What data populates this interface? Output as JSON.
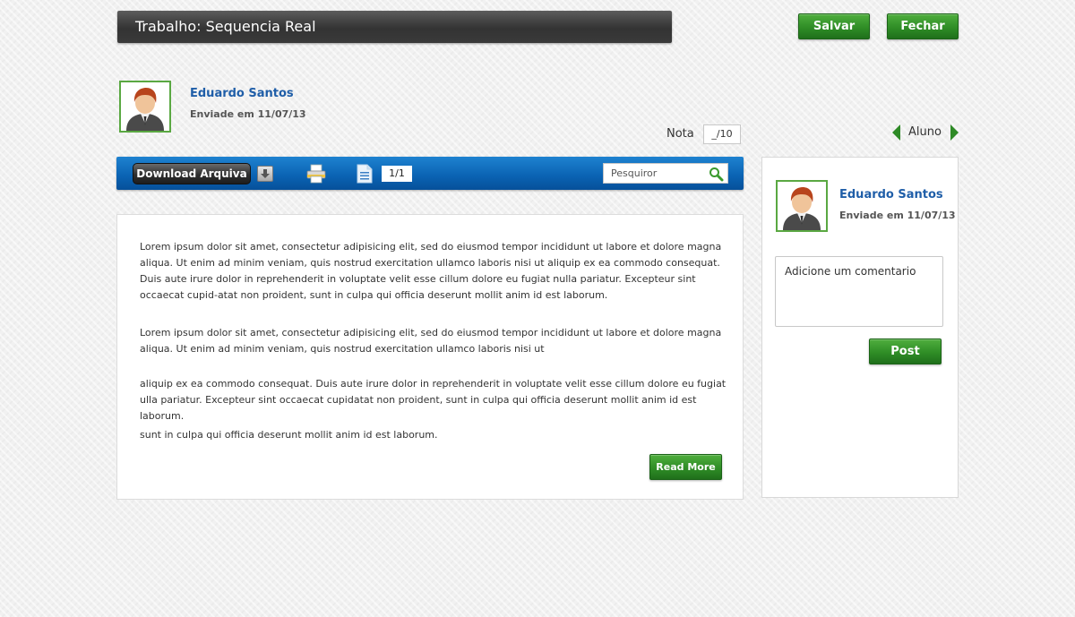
{
  "header": {
    "title": "Trabalho: Sequencia Real",
    "save_label": "Salvar",
    "close_label": "Fechar"
  },
  "submission": {
    "user_name": "Eduardo Santos",
    "sent_label": "Enviade em 11/07/13",
    "grade_label": "Nota",
    "grade_value": "_/10"
  },
  "student_nav": {
    "label": "Aluno"
  },
  "toolbar": {
    "download_label": "Download Arquiva",
    "page_count": "1/1",
    "search_placeholder": "Pesquiror"
  },
  "document": {
    "paragraphs": [
      "Lorem ipsum dolor sit amet, consectetur adipisicing elit, sed do eiusmod tempor incididunt ut labore et dolore magna aliqua. Ut enim ad minim veniam, quis nostrud exercitation ullamco laboris nisi ut aliquip ex ea commodo consequat. Duis aute irure dolor in reprehenderit in voluptate velit esse cillum dolore eu fugiat nulla pariatur. Excepteur sint occaecat cupid-atat non proident, sunt in culpa qui officia deserunt mollit anim id est laborum.",
      "Lorem ipsum dolor sit amet, consectetur adipisicing elit, sed do eiusmod tempor incididunt ut labore et dolore magna aliqua. Ut enim ad minim veniam, quis nostrud exercitation ullamco laboris nisi ut",
      "aliquip ex ea commodo consequat. Duis aute irure dolor in reprehenderit in voluptate velit esse cillum dolore eu fugiat ulla pariatur. Excepteur sint occaecat cupidatat non proident, sunt in culpa qui officia deserunt mollit anim id est laborum.",
      "sunt in culpa qui officia deserunt mollit anim id est laborum."
    ],
    "read_more_label": "Read More"
  },
  "side_panel": {
    "user_name": "Eduardo Santos",
    "sent_label": "Enviade em 11/07/13",
    "comment_placeholder": "Adicione um comentario",
    "post_label": "Post"
  },
  "icons": {
    "avatar": "user-avatar-icon",
    "print": "printer-icon",
    "document": "document-icon",
    "search": "magnifier-icon",
    "download": "download-arrow-icon",
    "prev": "arrow-left-icon",
    "next": "arrow-right-icon"
  },
  "colors": {
    "accent_green": "#2f8d26",
    "toolbar_blue": "#0a62b2",
    "link_blue": "#1f5ea8"
  }
}
